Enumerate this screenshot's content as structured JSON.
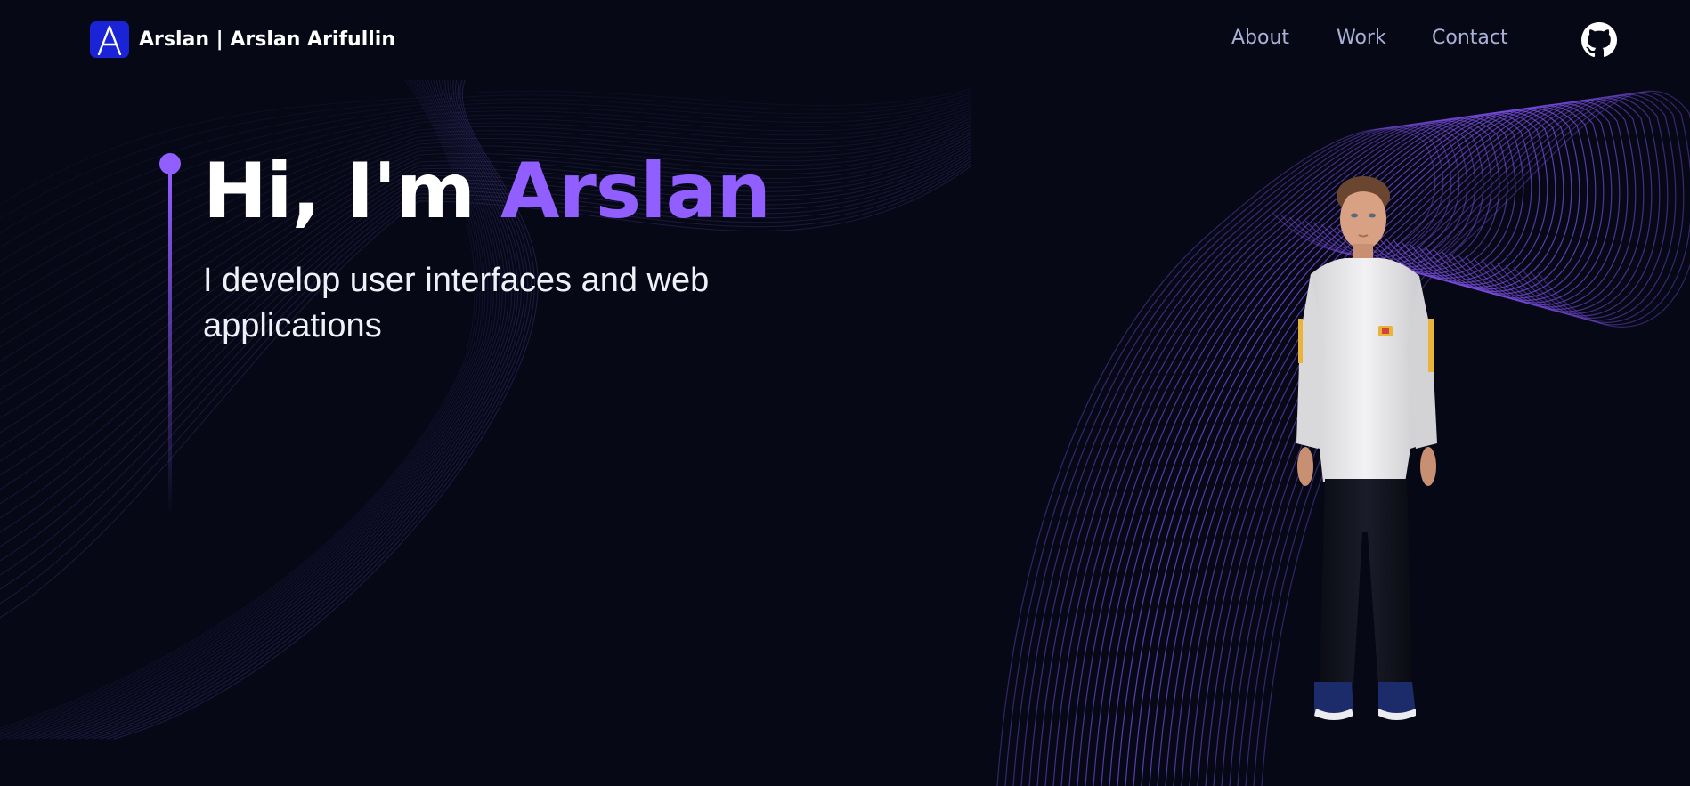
{
  "navbar": {
    "logo_letter": "A",
    "brand_text": "Arslan  | Arslan Arifullin",
    "links": [
      {
        "label": "About"
      },
      {
        "label": "Work"
      },
      {
        "label": "Contact"
      }
    ],
    "github_icon": "github-icon"
  },
  "hero": {
    "greeting": "Hi, I'm ",
    "name": "Arslan",
    "subtitle": "I develop user interfaces and web applications"
  },
  "colors": {
    "background": "#060816",
    "accent": "#915eff",
    "logo_bg": "#1a24d6",
    "nav_link": "#aab0d6"
  }
}
